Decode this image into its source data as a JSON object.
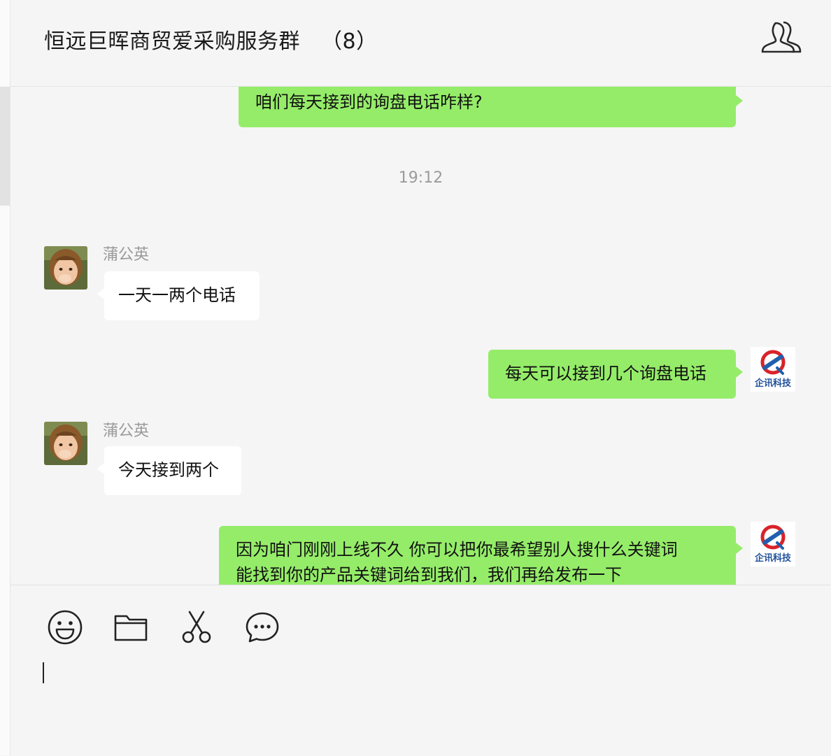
{
  "header": {
    "title": "恒远巨晖商贸爱采购服务群",
    "member_count": "（8）",
    "members_icon": "group-members-icon"
  },
  "messages": [
    {
      "direction": "out",
      "text": "咱们每天接到的询盘电话咋样?"
    },
    {
      "type": "timestamp",
      "text": "19:12"
    },
    {
      "direction": "in",
      "sender": "蒲公英",
      "text": "一天一两个电话"
    },
    {
      "direction": "out",
      "text": "每天可以接到几个询盘电话"
    },
    {
      "direction": "in",
      "sender": "蒲公英",
      "text": "今天接到两个"
    },
    {
      "direction": "out",
      "lines": [
        "因为咱门刚刚上线不久  你可以把你最希望别人搜什么关键词",
        "能找到你的产品关键词给到我们，我们再给发布一下"
      ]
    }
  ],
  "self_avatar_text": "企讯科技",
  "toolbar": {
    "icons": [
      "emoji-icon",
      "folder-icon",
      "scissors-icon",
      "chat-bubble-icon"
    ]
  },
  "input": {
    "value": ""
  },
  "colors": {
    "outgoing": "#95ec69",
    "incoming": "#ffffff",
    "background": "#f5f5f5"
  }
}
